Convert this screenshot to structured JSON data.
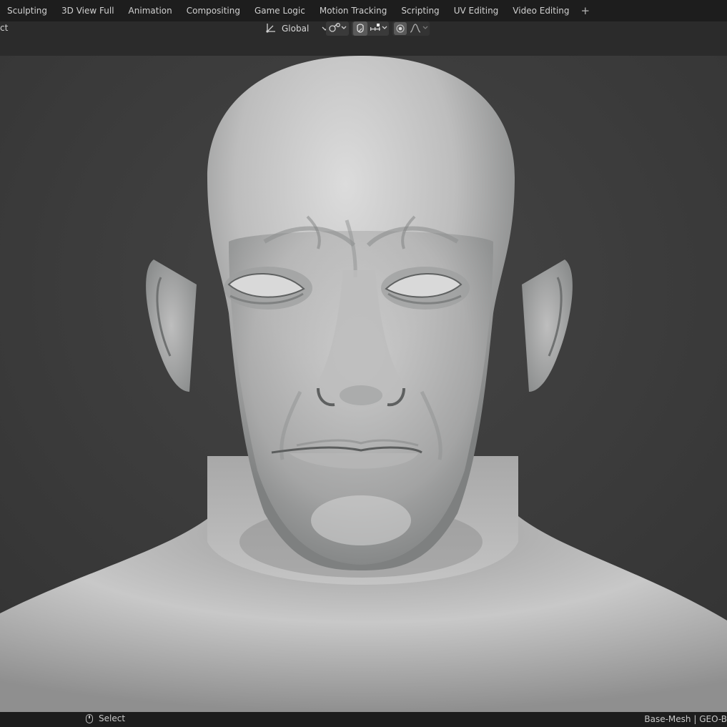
{
  "workspace_tabs": [
    {
      "label": "Sculpting"
    },
    {
      "label": "3D View Full"
    },
    {
      "label": "Animation"
    },
    {
      "label": "Compositing"
    },
    {
      "label": "Game Logic"
    },
    {
      "label": "Motion Tracking"
    },
    {
      "label": "Scripting"
    },
    {
      "label": "UV Editing"
    },
    {
      "label": "Video Editing"
    }
  ],
  "add_tab_label": "+",
  "header": {
    "left_label": "ct",
    "transform_orientation": "Global"
  },
  "icons": {
    "orientation": "transform-orientation-icon",
    "pivot": "pivot-point-icon",
    "snap": "snap-magnet-icon",
    "snap_target": "snap-increment-icon",
    "proportional": "proportional-editing-icon",
    "falloff": "falloff-curve-icon",
    "mouse": "mouse-left-click-icon"
  },
  "statusbar": {
    "select_label": "Select",
    "right_info": "Base-Mesh | GEO-B"
  },
  "colors": {
    "tab_bar": "#1d1d1d",
    "header": "#2b2b2b",
    "viewport": "#3d3d3d",
    "model": "#c9c9c9"
  }
}
